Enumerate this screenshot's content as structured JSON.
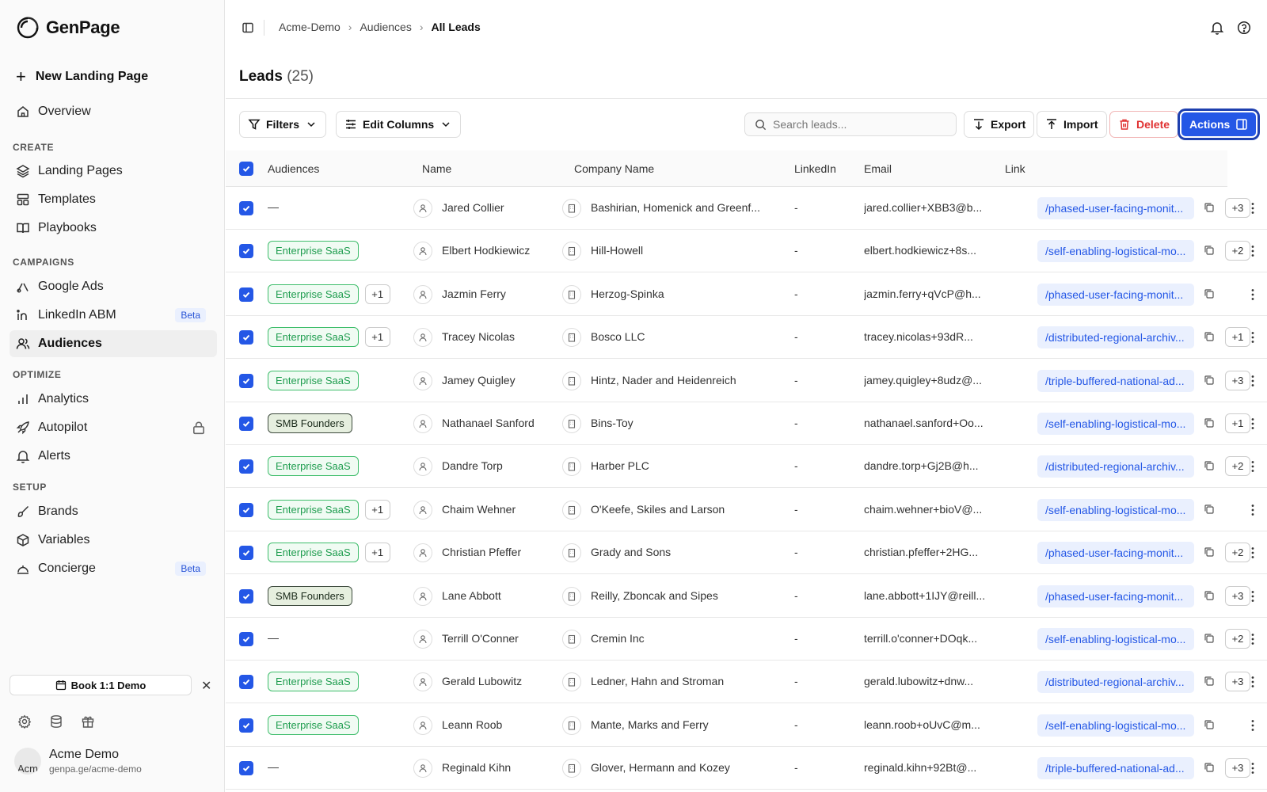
{
  "app": {
    "name": "GenPage"
  },
  "sidebar": {
    "new_page_label": "New Landing Page",
    "overview_label": "Overview",
    "sections": {
      "create": "CREATE",
      "campaigns": "CAMPAIGNS",
      "optimize": "OPTIMIZE",
      "setup": "SETUP"
    },
    "items": {
      "landing_pages": "Landing Pages",
      "templates": "Templates",
      "playbooks": "Playbooks",
      "google_ads": "Google Ads",
      "linkedin_abm": "LinkedIn ABM",
      "audiences": "Audiences",
      "analytics": "Analytics",
      "autopilot": "Autopilot",
      "alerts": "Alerts",
      "brands": "Brands",
      "variables": "Variables",
      "concierge": "Concierge"
    },
    "beta_label": "Beta",
    "book_demo_label": "Book 1:1 Demo",
    "close_glyph": "✕",
    "account": {
      "avatar_text": "Acm",
      "name": "Acme Demo",
      "url": "genpa.ge/acme-demo"
    }
  },
  "breadcrumb": {
    "items": [
      "Acme-Demo",
      "Audiences"
    ],
    "current": "All Leads"
  },
  "page": {
    "title": "Leads",
    "count": "(25)"
  },
  "toolbar": {
    "filters_label": "Filters",
    "edit_columns_label": "Edit Columns",
    "search_placeholder": "Search leads...",
    "export_label": "Export",
    "import_label": "Import",
    "delete_label": "Delete",
    "actions_label": "Actions"
  },
  "table": {
    "columns": [
      "Audiences",
      "Name",
      "Company Name",
      "LinkedIn",
      "Email",
      "Link"
    ],
    "rows": [
      {
        "audience": "",
        "audience_class": "",
        "audience_more": "",
        "name": "Jared Collier",
        "company": "Bashirian, Homenick and Greenf...",
        "linkedin": "-",
        "email": "jared.collier+XBB3@b...",
        "link": "/phased-user-facing-monit...",
        "link_more": "+3"
      },
      {
        "audience": "Enterprise SaaS",
        "audience_class": "green",
        "audience_more": "",
        "name": "Elbert Hodkiewicz",
        "company": "Hill-Howell",
        "linkedin": "-",
        "email": "elbert.hodkiewicz+8s...",
        "link": "/self-enabling-logistical-mo...",
        "link_more": "+2"
      },
      {
        "audience": "Enterprise SaaS",
        "audience_class": "green",
        "audience_more": "+1",
        "name": "Jazmin Ferry",
        "company": "Herzog-Spinka",
        "linkedin": "-",
        "email": "jazmin.ferry+qVcP@h...",
        "link": "/phased-user-facing-monit...",
        "link_more": ""
      },
      {
        "audience": "Enterprise SaaS",
        "audience_class": "green",
        "audience_more": "+1",
        "name": "Tracey Nicolas",
        "company": "Bosco LLC",
        "linkedin": "-",
        "email": "tracey.nicolas+93dR...",
        "link": "/distributed-regional-archiv...",
        "link_more": "+1"
      },
      {
        "audience": "Enterprise SaaS",
        "audience_class": "green",
        "audience_more": "",
        "name": "Jamey Quigley",
        "company": "Hintz, Nader and Heidenreich",
        "linkedin": "-",
        "email": "jamey.quigley+8udz@...",
        "link": "/triple-buffered-national-ad...",
        "link_more": "+3"
      },
      {
        "audience": "SMB Founders",
        "audience_class": "dark",
        "audience_more": "",
        "name": "Nathanael Sanford",
        "company": "Bins-Toy",
        "linkedin": "-",
        "email": "nathanael.sanford+Oo...",
        "link": "/self-enabling-logistical-mo...",
        "link_more": "+1"
      },
      {
        "audience": "Enterprise SaaS",
        "audience_class": "green",
        "audience_more": "",
        "name": "Dandre Torp",
        "company": "Harber PLC",
        "linkedin": "-",
        "email": "dandre.torp+Gj2B@h...",
        "link": "/distributed-regional-archiv...",
        "link_more": "+2"
      },
      {
        "audience": "Enterprise SaaS",
        "audience_class": "green",
        "audience_more": "+1",
        "name": "Chaim Wehner",
        "company": "O'Keefe, Skiles and Larson",
        "linkedin": "-",
        "email": "chaim.wehner+bioV@...",
        "link": "/self-enabling-logistical-mo...",
        "link_more": ""
      },
      {
        "audience": "Enterprise SaaS",
        "audience_class": "green",
        "audience_more": "+1",
        "name": "Christian Pfeffer",
        "company": "Grady and Sons",
        "linkedin": "-",
        "email": "christian.pfeffer+2HG...",
        "link": "/phased-user-facing-monit...",
        "link_more": "+2"
      },
      {
        "audience": "SMB Founders",
        "audience_class": "dark",
        "audience_more": "",
        "name": "Lane Abbott",
        "company": "Reilly, Zboncak and Sipes",
        "linkedin": "-",
        "email": "lane.abbott+1IJY@reill...",
        "link": "/phased-user-facing-monit...",
        "link_more": "+3"
      },
      {
        "audience": "",
        "audience_class": "",
        "audience_more": "",
        "name": "Terrill O'Conner",
        "company": "Cremin Inc",
        "linkedin": "-",
        "email": "terrill.o'conner+DOqk...",
        "link": "/self-enabling-logistical-mo...",
        "link_more": "+2"
      },
      {
        "audience": "Enterprise SaaS",
        "audience_class": "green",
        "audience_more": "",
        "name": "Gerald Lubowitz",
        "company": "Ledner, Hahn and Stroman",
        "linkedin": "-",
        "email": "gerald.lubowitz+dnw...",
        "link": "/distributed-regional-archiv...",
        "link_more": "+3"
      },
      {
        "audience": "Enterprise SaaS",
        "audience_class": "green",
        "audience_more": "",
        "name": "Leann Roob",
        "company": "Mante, Marks and Ferry",
        "linkedin": "-",
        "email": "leann.roob+oUvC@m...",
        "link": "/self-enabling-logistical-mo...",
        "link_more": ""
      },
      {
        "audience": "",
        "audience_class": "",
        "audience_more": "",
        "name": "Reginald Kihn",
        "company": "Glover, Hermann and Kozey",
        "linkedin": "-",
        "email": "reginald.kihn+92Bt@...",
        "link": "/triple-buffered-national-ad...",
        "link_more": "+3"
      }
    ],
    "empty_audience": "—"
  },
  "colors": {
    "accent": "#2457e6",
    "tag_green": "#1f9d4f",
    "delete": "#e03131"
  }
}
